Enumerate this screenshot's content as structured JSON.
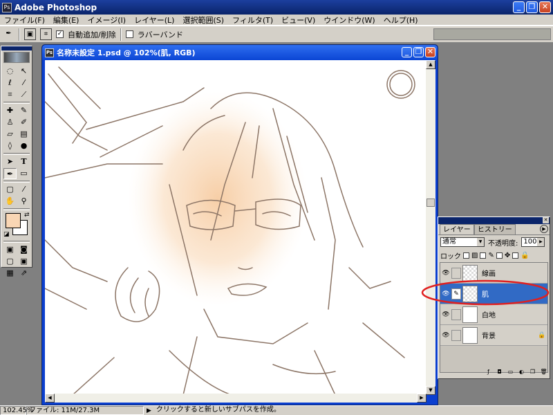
{
  "app": {
    "title": "Adobe Photoshop",
    "icon": "photoshop-icon"
  },
  "window_controls": {
    "minimize": "_",
    "restore": "❐",
    "close": "✕"
  },
  "menu": [
    "ファイル(F)",
    "編集(E)",
    "イメージ(I)",
    "レイヤー(L)",
    "選択範囲(S)",
    "フィルタ(T)",
    "ビュー(V)",
    "ウインドウ(W)",
    "ヘルプ(H)"
  ],
  "options_bar": {
    "tool_icon": "pen-icon",
    "auto_add_delete": {
      "label": "自動追加/削除",
      "checked": true
    },
    "rubber_band": {
      "label": "ラバーバンド",
      "checked": false
    }
  },
  "tools": [
    "marquee",
    "move",
    "lasso",
    "magic-wand",
    "crop",
    "slice",
    "healing",
    "brush",
    "stamp",
    "history-brush",
    "eraser",
    "gradient",
    "blur",
    "dodge",
    "path-select",
    "type",
    "pen",
    "shape",
    "notes",
    "eyedropper",
    "hand",
    "zoom"
  ],
  "colors": {
    "foreground": "#f9d6b4",
    "background": "#ffffff"
  },
  "document": {
    "title": "名称未設定 1.psd @ 102%(肌, RGB)"
  },
  "layers_panel": {
    "tabs": [
      {
        "label": "レイヤー",
        "active": true
      },
      {
        "label": "ヒストリー",
        "active": false
      }
    ],
    "blend_mode": "通常",
    "opacity_label": "不透明度:",
    "opacity_value": "100%",
    "lock_label": "ロック",
    "layers": [
      {
        "name": "線画",
        "visible": true,
        "active": false,
        "locked": false,
        "thumb": "transparent"
      },
      {
        "name": "肌",
        "visible": true,
        "active": true,
        "locked": false,
        "thumb": "transparent"
      },
      {
        "name": "白地",
        "visible": true,
        "active": false,
        "locked": false,
        "thumb": "white"
      },
      {
        "name": "背景",
        "visible": true,
        "active": false,
        "locked": true,
        "thumb": "white"
      }
    ]
  },
  "statusbar": {
    "zoom": "102.45%",
    "file_info": "ファイル: 11M/27.3M",
    "hint": "クリックすると新しいサブパスを作成。"
  }
}
